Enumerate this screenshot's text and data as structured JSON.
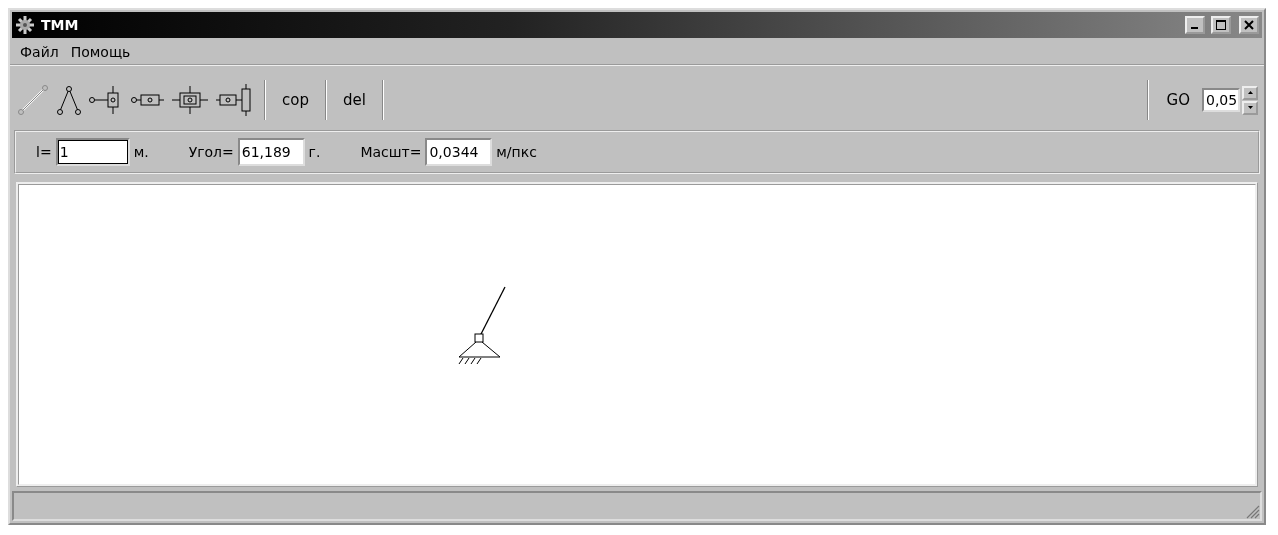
{
  "window": {
    "title": "ТММ"
  },
  "menu": [
    {
      "label": "Файл"
    },
    {
      "label": "Помощь"
    }
  ],
  "toolbar": {
    "tools": [
      {
        "kind": "link"
      },
      {
        "kind": "dyad"
      },
      {
        "kind": "slider-pin"
      },
      {
        "kind": "slider"
      },
      {
        "kind": "slider-cross"
      },
      {
        "kind": "slider-guide"
      }
    ],
    "buttons": [
      {
        "label": "cop"
      },
      {
        "label": "del"
      }
    ],
    "go_label": "GO",
    "step": {
      "value": "0,05"
    }
  },
  "params": [
    {
      "label": "l=",
      "value": "1",
      "unit": "м.",
      "focused": true
    },
    {
      "label": "Угол=",
      "value": "61,189",
      "unit": "г.",
      "focused": false
    },
    {
      "label": "Масшт=",
      "value": "0,0344",
      "unit": "м/пкс",
      "focused": false
    }
  ]
}
